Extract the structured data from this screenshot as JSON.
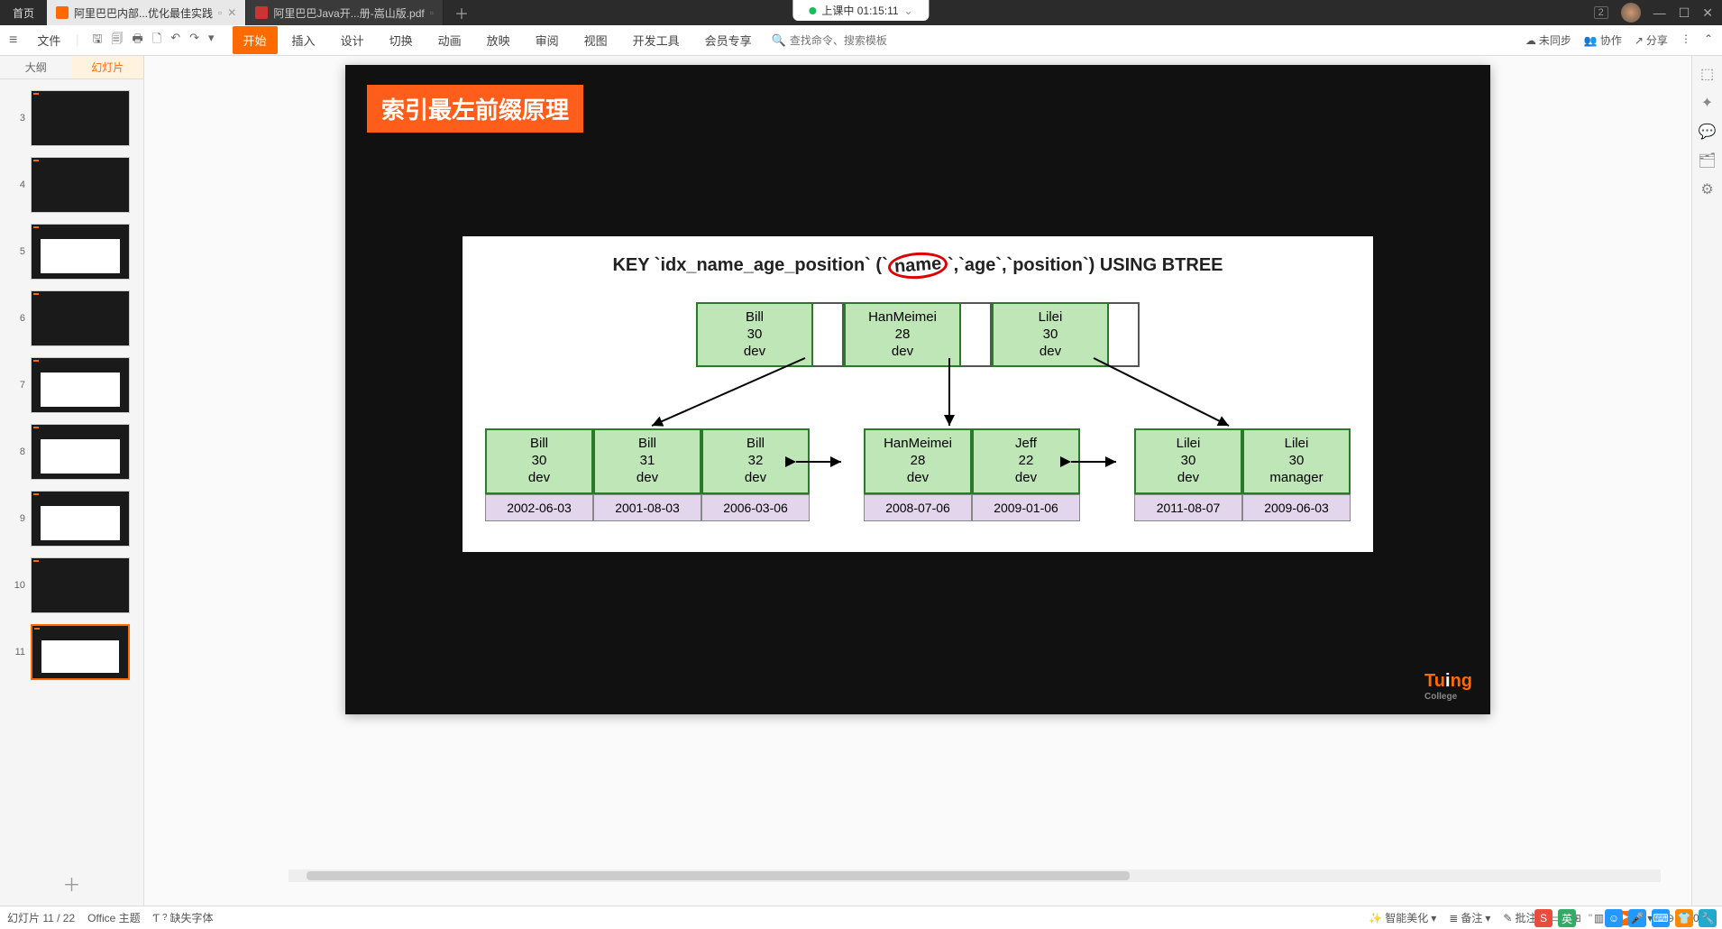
{
  "tabbar": {
    "home": "首页",
    "doc1": "阿里巴巴内部...优化最佳实践",
    "doc2": "阿里巴巴Java开...册-嵩山版.pdf",
    "session": "上课中 01:15:11",
    "badge_num": "2"
  },
  "menu": {
    "file": "文件",
    "tabs": [
      "开始",
      "插入",
      "设计",
      "切换",
      "动画",
      "放映",
      "审阅",
      "视图",
      "开发工具",
      "会员专享"
    ],
    "search_placeholder": "查找命令、搜索模板",
    "right": {
      "unsync": "未同步",
      "coop": "协作",
      "share": "分享"
    }
  },
  "left": {
    "outline": "大纲",
    "slides": "幻灯片",
    "nums": [
      "3",
      "4",
      "5",
      "6",
      "7",
      "8",
      "9",
      "10",
      "11"
    ]
  },
  "slide": {
    "title": "索引最左前缀原理",
    "key_prefix": "KEY `idx_name_age_position` (`",
    "key_c1": "name",
    "key_mid": "`,`age`,`position`) USING BTREE",
    "top_nodes": [
      {
        "name": "Bill",
        "age": "30",
        "pos": "dev"
      },
      {
        "name": "HanMeimei",
        "age": "28",
        "pos": "dev"
      },
      {
        "name": "Lilei",
        "age": "30",
        "pos": "dev"
      }
    ],
    "groups": [
      {
        "leaves": [
          {
            "name": "Bill",
            "age": "30",
            "pos": "dev",
            "date": "2002-06-03"
          },
          {
            "name": "Bill",
            "age": "31",
            "pos": "dev",
            "date": "2001-08-03"
          },
          {
            "name": "Bill",
            "age": "32",
            "pos": "dev",
            "date": "2006-03-06"
          }
        ]
      },
      {
        "leaves": [
          {
            "name": "HanMeimei",
            "age": "28",
            "pos": "dev",
            "date": "2008-07-06"
          },
          {
            "name": "Jeff",
            "age": "22",
            "pos": "dev",
            "date": "2009-01-06"
          }
        ]
      },
      {
        "leaves": [
          {
            "name": "Lilei",
            "age": "30",
            "pos": "dev",
            "date": "2011-08-07"
          },
          {
            "name": "Lilei",
            "age": "30",
            "pos": "manager",
            "date": "2009-06-03"
          }
        ]
      }
    ],
    "logo1": "Tu",
    "logo2": "i",
    "logo3": "ng",
    "logo_sub": "College"
  },
  "status": {
    "page": "幻灯片 11 / 22",
    "theme": "Office 主题",
    "missing_font": "缺失字体",
    "beautify": "智能美化",
    "notes": "备注",
    "review": "批注",
    "zoom": "100%"
  }
}
